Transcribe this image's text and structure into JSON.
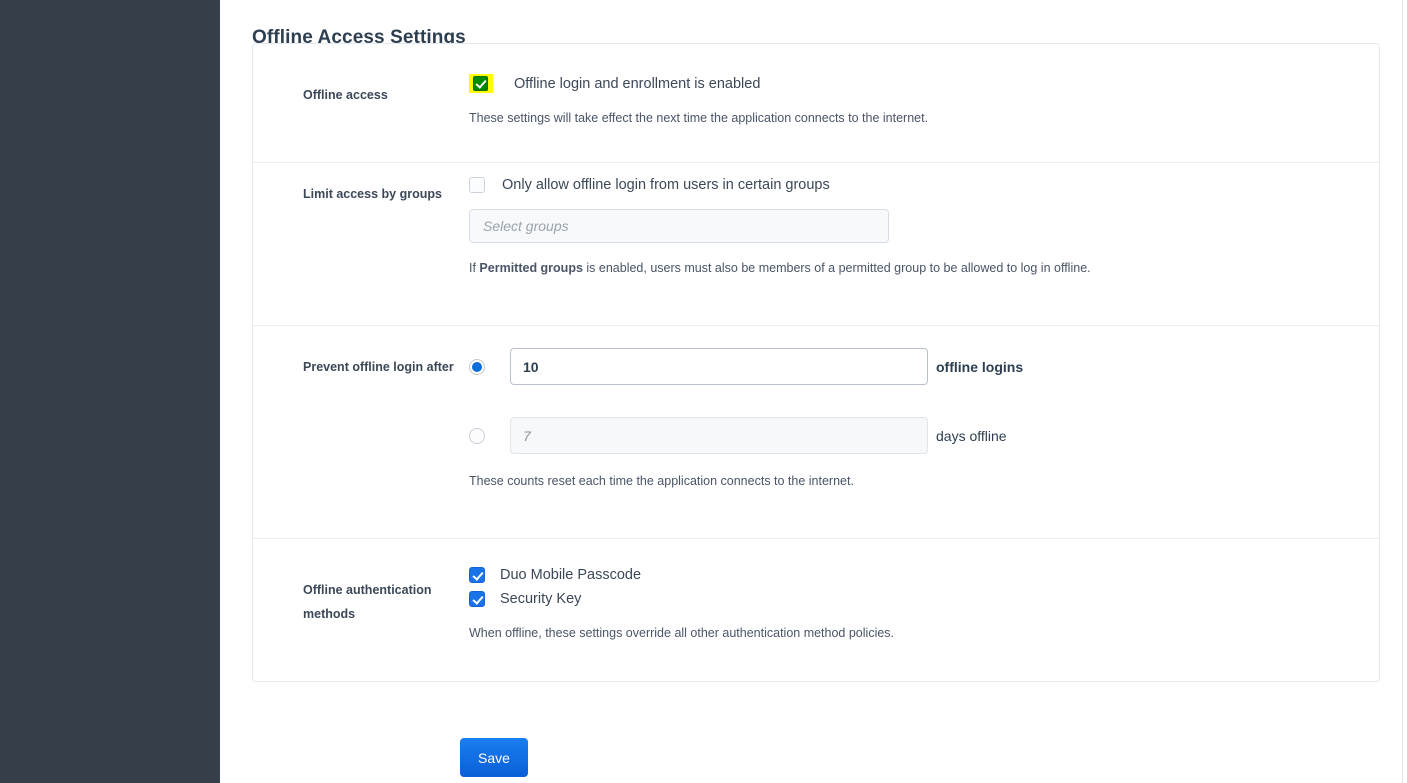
{
  "page": {
    "title": "Offline Access Settings"
  },
  "sections": {
    "offline_access": {
      "label": "Offline access",
      "checkbox_label": "Offline login and enrollment is enabled",
      "checked": true,
      "highlight_color": "#ffff00",
      "checkbox_color": "#008a00",
      "help": "These settings will take effect the next time the application connects to the internet."
    },
    "limit_groups": {
      "label": "Limit access by groups",
      "checkbox_label": "Only allow offline login from users in certain groups",
      "checked": false,
      "select_placeholder": "Select groups",
      "help_prefix": "If ",
      "help_bold": "Permitted groups",
      "help_suffix": " is enabled, users must also be members of a permitted group to be allowed to log in offline."
    },
    "prevent_login": {
      "label": "Prevent offline login after",
      "option_logins": {
        "selected": true,
        "value": "10",
        "unit": "offline logins"
      },
      "option_days": {
        "selected": false,
        "value": "7",
        "unit": "days offline"
      },
      "help": "These counts reset each time the application connects to the internet."
    },
    "auth_methods": {
      "label": "Offline authentication methods",
      "items": [
        {
          "label": "Duo Mobile Passcode",
          "checked": true
        },
        {
          "label": "Security Key",
          "checked": true
        }
      ],
      "help": "When offline, these settings override all other authentication method policies."
    }
  },
  "footer": {
    "save_label": "Save",
    "save_color": "#0a6ed8"
  }
}
